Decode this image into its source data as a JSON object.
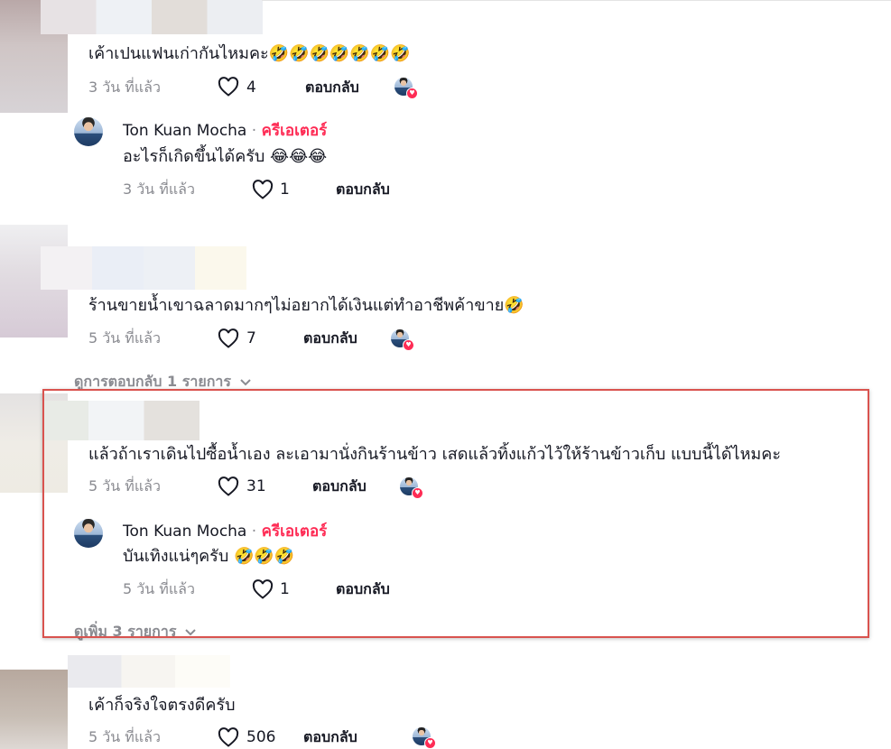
{
  "comments": [
    {
      "text": "เค้าเปนแฟนเก่ากันไหมคะ🤣🤣🤣🤣🤣🤣🤣",
      "time": "3 วัน ที่แล้ว",
      "likes": "4",
      "reply_label": "ตอบกลับ",
      "creator_reply": {
        "name": "Ton Kuan Mocha",
        "dot": "·",
        "badge": "ครีเอเตอร์",
        "text": "อะไรก็เกิดขึ้นได้ครับ 😂😂😂",
        "time": "3 วัน ที่แล้ว",
        "likes": "1",
        "reply_label": "ตอบกลับ"
      }
    },
    {
      "text": "ร้านขายน้ำเขาฉลาดมากๆไม่อยากได้เงินแต่ทำอาชีพค้าขาย🤣",
      "time": "5 วัน ที่แล้ว",
      "likes": "7",
      "reply_label": "ตอบกลับ",
      "view_replies": "ดูการตอบกลับ 1 รายการ"
    },
    {
      "text": "แล้วถ้าเราเดินไปซื้อน้ำเอง ละเอามานั่งกินร้านข้าว เสดแล้วทิ้งแก้วไว้ให้ร้านข้าวเก็บ แบบนี้ได้ไหมคะ",
      "time": "5 วัน ที่แล้ว",
      "likes": "31",
      "reply_label": "ตอบกลับ",
      "creator_reply": {
        "name": "Ton Kuan Mocha",
        "dot": "·",
        "badge": "ครีเอเตอร์",
        "text": "บันเทิงแน่ๆครับ 🤣🤣🤣",
        "time": "5 วัน ที่แล้ว",
        "likes": "1",
        "reply_label": "ตอบกลับ"
      },
      "view_more": "ดูเพิ่ม 3 รายการ"
    },
    {
      "text": "เค้าก็จริงใจตรงดีครับ",
      "time": "5 วัน ที่แล้ว",
      "likes": "506",
      "reply_label": "ตอบกลับ"
    }
  ],
  "colors": {
    "accent": "#fe2c55",
    "muted_text": "#8a8b91",
    "highlight_border": "#d9534f"
  },
  "icons": {
    "like": "heart-outline-icon",
    "chevron": "chevron-down-icon",
    "creator_liked": "creator-liked-avatar-icon"
  }
}
